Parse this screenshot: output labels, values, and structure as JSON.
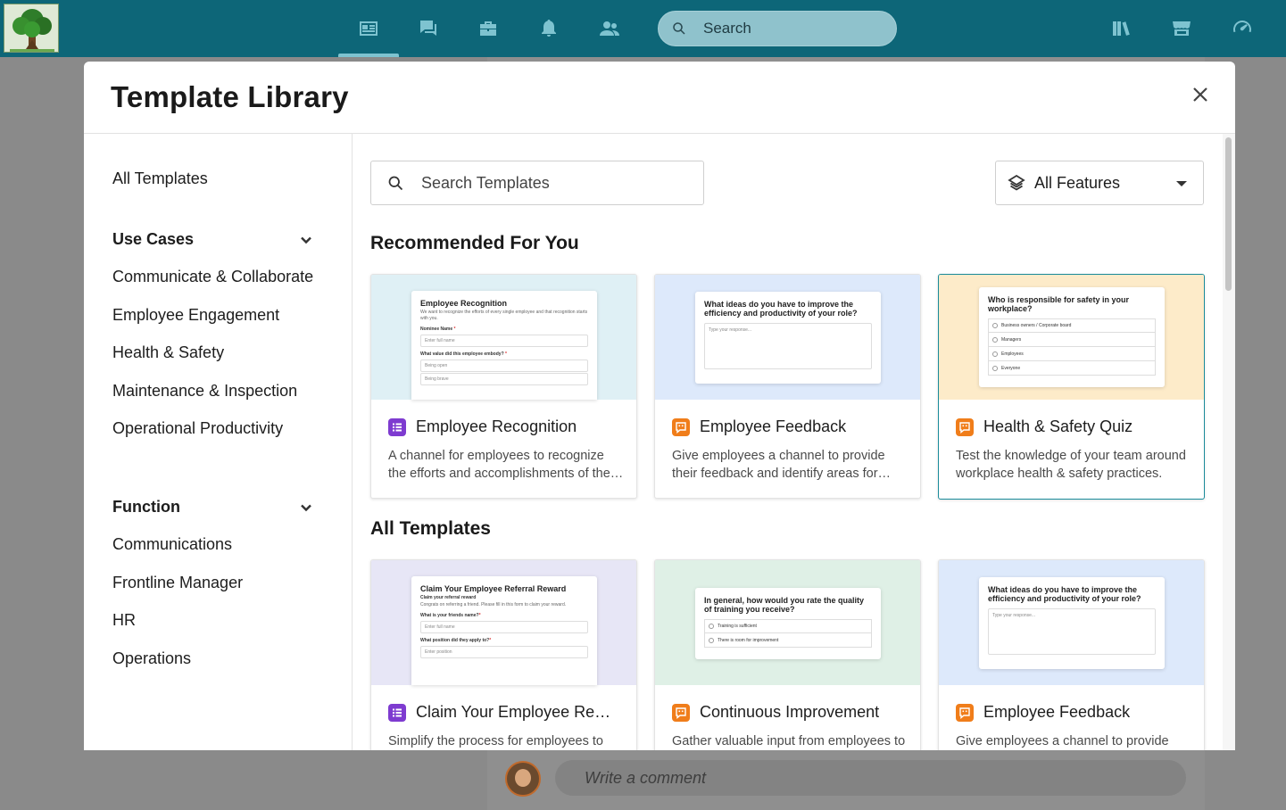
{
  "topbar": {
    "search_label": "Search",
    "nav_icons": [
      "newsfeed-icon",
      "chat-icon",
      "toolbox-icon",
      "bell-icon",
      "people-icon",
      "library-icon",
      "store-icon",
      "speedometer-icon"
    ]
  },
  "background": {
    "comment_placeholder": "Write a comment"
  },
  "modal": {
    "title": "Template Library",
    "close_icon": "close-icon"
  },
  "sidebar": {
    "all_templates": "All Templates",
    "use_cases": {
      "label": "Use Cases",
      "items": [
        "Communicate & Collaborate",
        "Employee Engagement",
        "Health & Safety",
        "Maintenance & Inspection",
        "Operational Productivity"
      ]
    },
    "function": {
      "label": "Function",
      "items": [
        "Communications",
        "Frontline Manager",
        "HR",
        "Operations"
      ]
    }
  },
  "content": {
    "search_placeholder": "Search Templates",
    "features_label": "All Features",
    "recommended_title": "Recommended For You",
    "all_title": "All Templates",
    "recommended": [
      {
        "title": "Employee Recognition",
        "desc": "A channel for employees to recognize the efforts and accomplishments of their colleagues.",
        "badge": "form-list-icon",
        "badge_color": "#7e3bd0",
        "thumb_bg": "#dff0f5",
        "preview": {
          "title": "Employee Recognition",
          "sub": "We want to recognize the efforts of every single employee and that recognition starts with you.",
          "q1": "Nominee Name",
          "f1": "Enter full name",
          "q2": "What value did this employee embody?",
          "o1": "Being open",
          "o2": "Being brave"
        }
      },
      {
        "title": "Employee Feedback",
        "desc": "Give employees a channel to provide their feedback and identify areas for improvement.",
        "badge": "survey-bubble-icon",
        "badge_color": "#f07d1a",
        "thumb_bg": "#dde9fb",
        "preview": {
          "title": "What ideas do you have to improve the efficiency and productivity of your role?",
          "field": "Type your response..."
        }
      },
      {
        "title": "Health & Safety Quiz",
        "desc": "Test the knowledge of your team around workplace health & safety practices.",
        "badge": "survey-bubble-icon",
        "badge_color": "#f07d1a",
        "thumb_bg": "#fdebc9",
        "preview": {
          "title": "Who is responsible for safety in your workplace?",
          "options": [
            "Business owners / Corporate board",
            "Managers",
            "Employees",
            "Everyone"
          ]
        }
      }
    ],
    "all": [
      {
        "title": "Claim Your Employee Referral Reward",
        "desc": "Simplify the process for employees to claim their referral rewards.",
        "badge": "form-list-icon",
        "badge_color": "#7e3bd0",
        "thumb_bg": "#e7e6f6",
        "preview": {
          "title": "Claim Your Employee Referral Reward",
          "q0": "Claim your referral reward",
          "sub": "Congrats on referring a friend. Please fill in this form to claim your reward.",
          "q1": "What is your friends name?",
          "f1": "Enter full name",
          "q2": "What position did they apply to?",
          "f2": "Enter position"
        }
      },
      {
        "title": "Continuous Improvement",
        "desc": "Gather valuable input from employees to improve the quality of training.",
        "badge": "survey-bubble-icon",
        "badge_color": "#f07d1a",
        "thumb_bg": "#dff0e6",
        "preview": {
          "title": "In general, how would you rate the quality of training you receive?",
          "options": [
            "Training is sufficient",
            "There is room for improvement"
          ]
        }
      },
      {
        "title": "Employee Feedback",
        "desc": "Give employees a channel to provide their feedback and identify areas for improvement.",
        "badge": "survey-bubble-icon",
        "badge_color": "#f07d1a",
        "thumb_bg": "#dde9fb",
        "preview": {
          "title": "What ideas do you have to improve the efficiency and productivity of your role?",
          "field": "Type your response..."
        }
      }
    ]
  }
}
